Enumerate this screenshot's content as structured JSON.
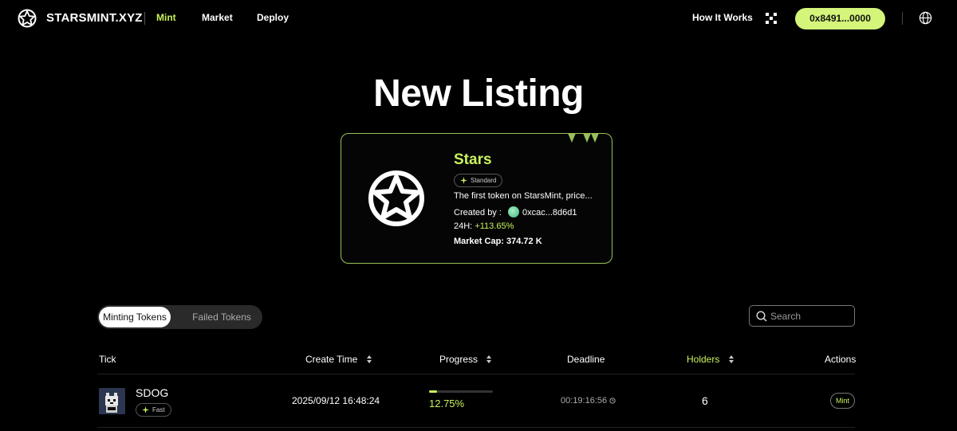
{
  "nav": {
    "brand": "STARSMINT.XYZ",
    "links": [
      "Mint",
      "Market",
      "Deploy"
    ],
    "how_it_works": "How It Works",
    "wallet": "0x8491...0000"
  },
  "hero": {
    "title": "New Listing"
  },
  "featured": {
    "name": "Stars",
    "badge": "Standard",
    "description": "The first token on StarsMint, price...",
    "created_by_label": "Created by :",
    "creator": "0xcac...8d6d1",
    "change_label": "24H:",
    "change_value": "+113.65%",
    "market_cap": "Market Cap: 374.72 K"
  },
  "tabs": {
    "active": "Minting Tokens",
    "inactive": "Failed Tokens"
  },
  "search": {
    "placeholder": "Search"
  },
  "table": {
    "headers": {
      "tick": "Tick",
      "create_time": "Create Time",
      "progress": "Progress",
      "deadline": "Deadline",
      "holders": "Holders",
      "actions": "Actions"
    },
    "rows": [
      {
        "tick": "SDOG",
        "badge": "Fast",
        "create_time": "2025/09/12 16:48:24",
        "progress_text": "12.75%",
        "progress": 0.1275,
        "deadline": "00:19:16:56",
        "holders": "6",
        "action": "Mint"
      }
    ]
  },
  "colors": {
    "accent": "#c8f25e",
    "wallet_bg": "#d4f57a",
    "card_border": "#98c259"
  }
}
